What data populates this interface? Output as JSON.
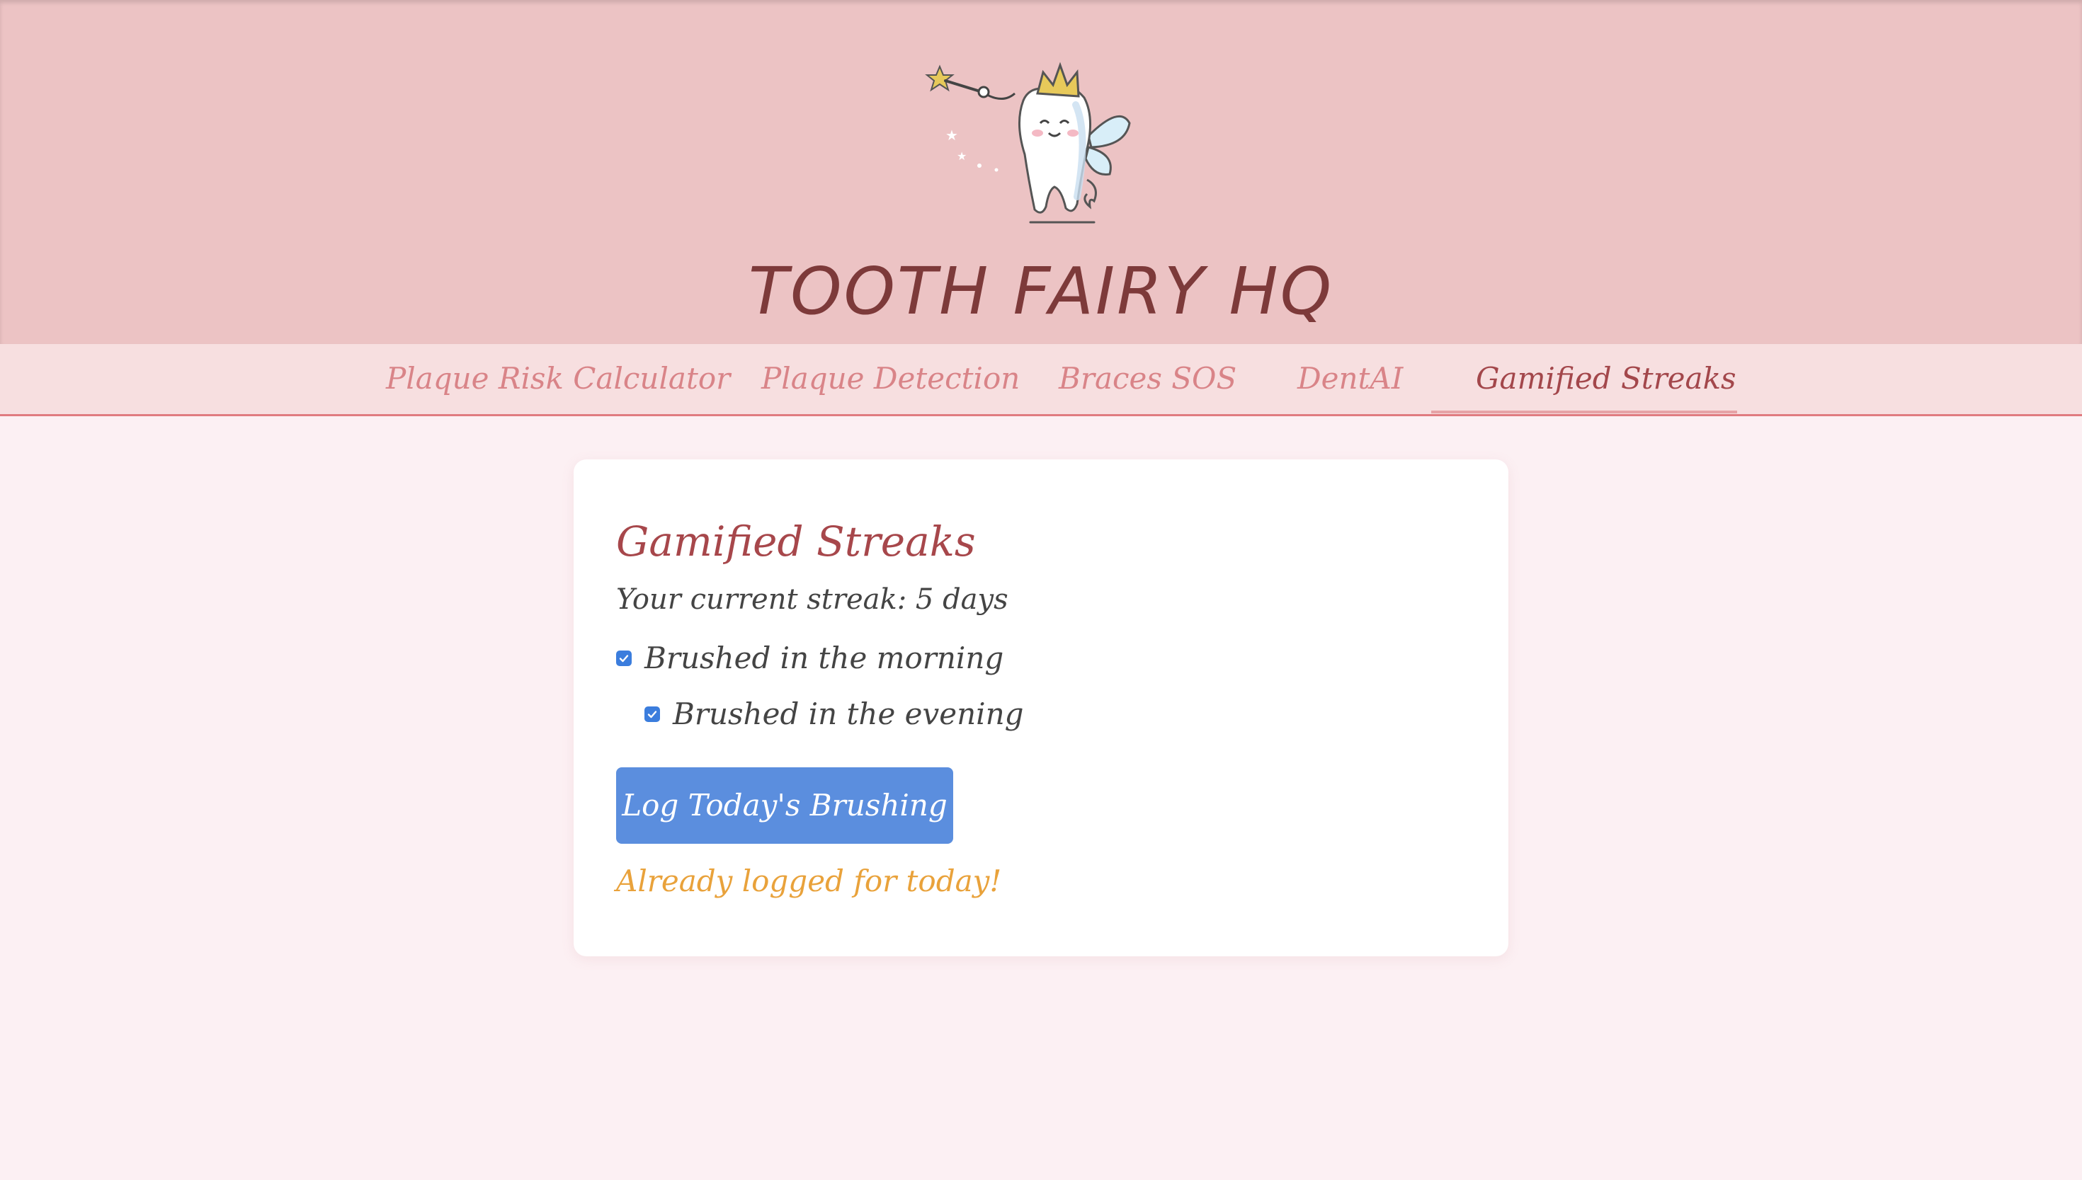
{
  "header": {
    "title": "TOOTH FAIRY HQ",
    "logo_icon": "tooth-fairy-logo-icon"
  },
  "nav": {
    "items": [
      {
        "label": "Plaque Risk Calculator",
        "active": false
      },
      {
        "label": "Plaque Detection",
        "active": false
      },
      {
        "label": "Braces SOS",
        "active": false
      },
      {
        "label": "DentAI",
        "active": false
      },
      {
        "label": "Gamified Streaks",
        "active": true
      }
    ]
  },
  "main": {
    "title": "Gamified Streaks",
    "streak_text": "Your current streak: 5 days",
    "checks": [
      {
        "label": "Brushed in the morning",
        "checked": true
      },
      {
        "label": "Brushed in the evening",
        "checked": true
      }
    ],
    "log_button_label": "Log Today's Brushing",
    "status_message": "Already logged for today!"
  },
  "colors": {
    "header_bg": "#ecc3c4",
    "nav_bg": "#f7dfe0",
    "page_bg": "#fcf0f3",
    "title": "#7d3a3a",
    "accent": "#a7474b",
    "button": "#5b8ede",
    "warning": "#e9a23b",
    "checkbox": "#3b7ddd"
  }
}
